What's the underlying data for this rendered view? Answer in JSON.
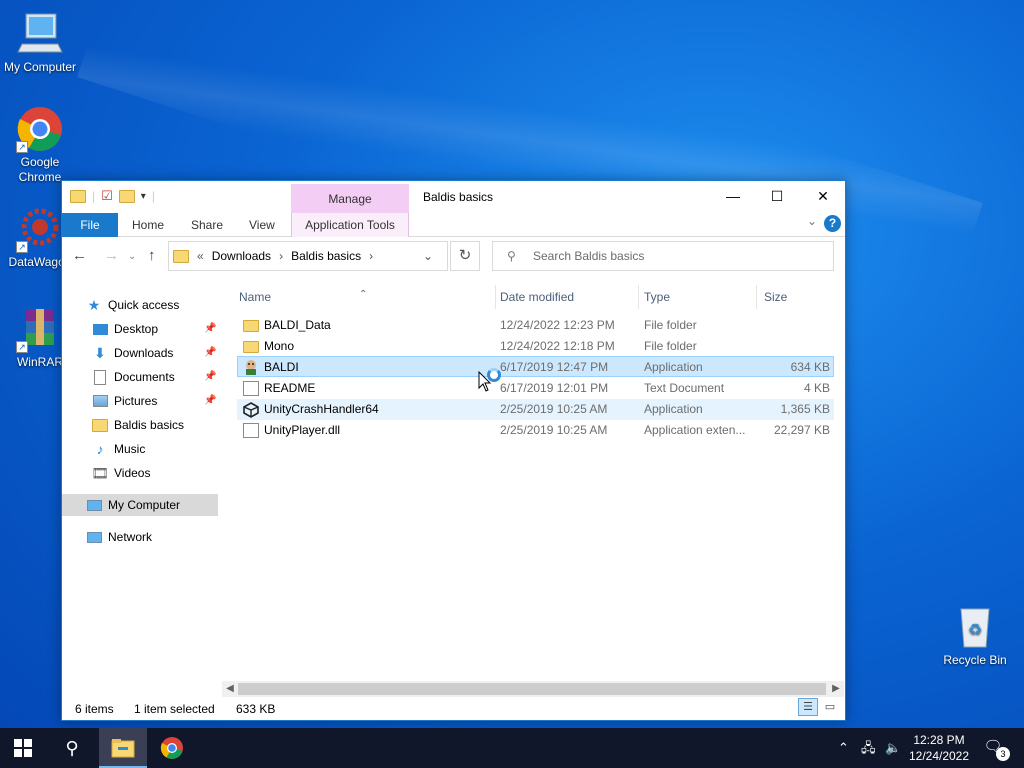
{
  "desktop": {
    "icons": [
      {
        "label": "My Computer"
      },
      {
        "label": "Google Chrome"
      },
      {
        "label": "DataWagon"
      },
      {
        "label": "WinRAR"
      },
      {
        "label": "Recycle Bin"
      }
    ]
  },
  "window": {
    "title": "Baldis basics",
    "manage_label": "Manage",
    "ribbon_tabs": [
      "File",
      "Home",
      "Share",
      "View",
      "Application Tools"
    ],
    "help_label": "?",
    "address": {
      "root_marker": "«",
      "crumbs": [
        "Downloads",
        "Baldis basics"
      ]
    },
    "search_placeholder": "Search Baldis basics",
    "sidebar": [
      {
        "label": "Quick access"
      },
      {
        "label": "Desktop"
      },
      {
        "label": "Downloads"
      },
      {
        "label": "Documents"
      },
      {
        "label": "Pictures"
      },
      {
        "label": "Baldis basics"
      },
      {
        "label": "Music"
      },
      {
        "label": "Videos"
      },
      {
        "label": "My Computer"
      },
      {
        "label": "Network"
      }
    ],
    "columns": [
      "Name",
      "Date modified",
      "Type",
      "Size"
    ],
    "files": [
      {
        "name": "BALDI_Data",
        "date": "12/24/2022 12:23 PM",
        "type": "File folder",
        "size": ""
      },
      {
        "name": "Mono",
        "date": "12/24/2022 12:18 PM",
        "type": "File folder",
        "size": ""
      },
      {
        "name": "BALDI",
        "date": "6/17/2019 12:47 PM",
        "type": "Application",
        "size": "634 KB"
      },
      {
        "name": "README",
        "date": "6/17/2019 12:01 PM",
        "type": "Text Document",
        "size": "4 KB"
      },
      {
        "name": "UnityCrashHandler64",
        "date": "2/25/2019 10:25 AM",
        "type": "Application",
        "size": "1,365 KB"
      },
      {
        "name": "UnityPlayer.dll",
        "date": "2/25/2019 10:25 AM",
        "type": "Application exten...",
        "size": "22,297 KB"
      }
    ],
    "status": {
      "items": "6 items",
      "selected": "1 item selected",
      "size": "633 KB"
    }
  },
  "taskbar": {
    "time": "12:28 PM",
    "date": "12/24/2022",
    "notification_count": "3"
  },
  "colors": {
    "accent": "#1979ca",
    "selection": "#cce8ff",
    "manage_tab": "#f4cdf4",
    "taskbar": "#10172a"
  }
}
